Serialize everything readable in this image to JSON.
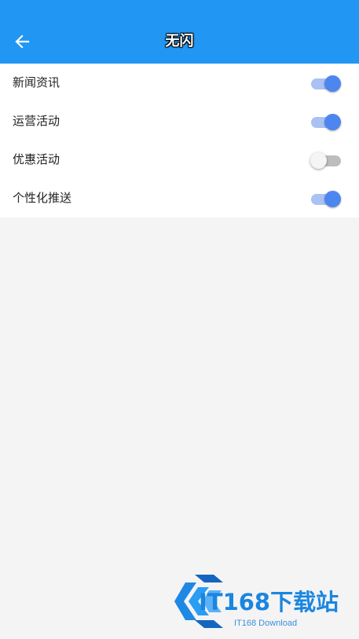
{
  "app_bar": {
    "title": "无闪",
    "back_icon": "arrow-left-icon",
    "color": "#2196f3"
  },
  "settings": [
    {
      "label": "新闻资讯",
      "enabled": true
    },
    {
      "label": "运营活动",
      "enabled": true
    },
    {
      "label": "优惠活动",
      "enabled": false
    },
    {
      "label": "个性化推送",
      "enabled": true
    }
  ],
  "switch_colors": {
    "on_thumb": "#4d86ee",
    "on_track": "#a9c1f3",
    "off_thumb": "#f5f5f5",
    "off_track": "#bdbdbd"
  },
  "watermark": {
    "brand": "IT168下载站",
    "subtitle": "IT168 Download"
  }
}
